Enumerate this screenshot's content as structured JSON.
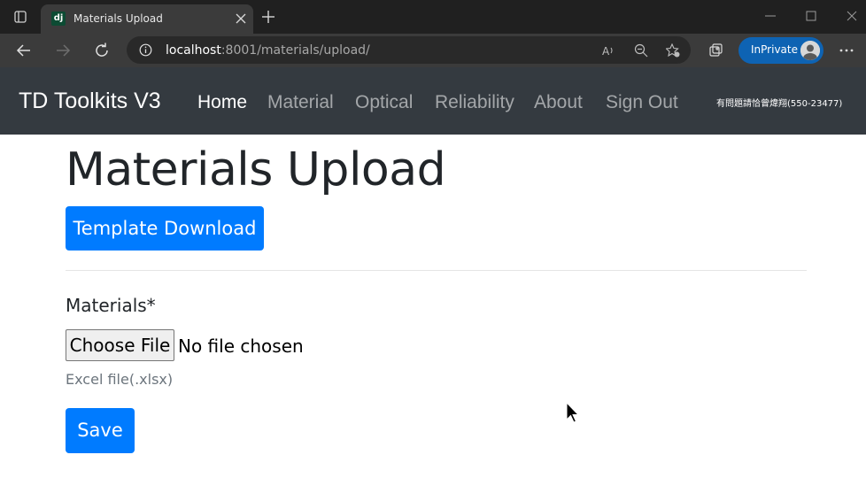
{
  "browser": {
    "tab_title": "Materials Upload",
    "tab_favicon": "dj",
    "url_host": "localhost",
    "url_rest": ":8001/materials/upload/",
    "inprivate_label": "InPrivate"
  },
  "navbar": {
    "brand": "TD Toolkits V3",
    "links": [
      "Home",
      "Material",
      "Optical",
      "Reliability",
      "About",
      "Sign Out"
    ],
    "active_link": "Home",
    "contact": "有問題請恰曾煒翔(550-23477)"
  },
  "main": {
    "title": "Materials Upload",
    "template_button": "Template Download",
    "field_label": "Materials*",
    "file_button": "Choose File",
    "file_status": "No file chosen",
    "help_text": "Excel file(.xlsx)",
    "save_button": "Save"
  },
  "colors": {
    "navbar_bg": "#343a40",
    "primary": "#007bff",
    "muted_text": "#6c757d"
  }
}
